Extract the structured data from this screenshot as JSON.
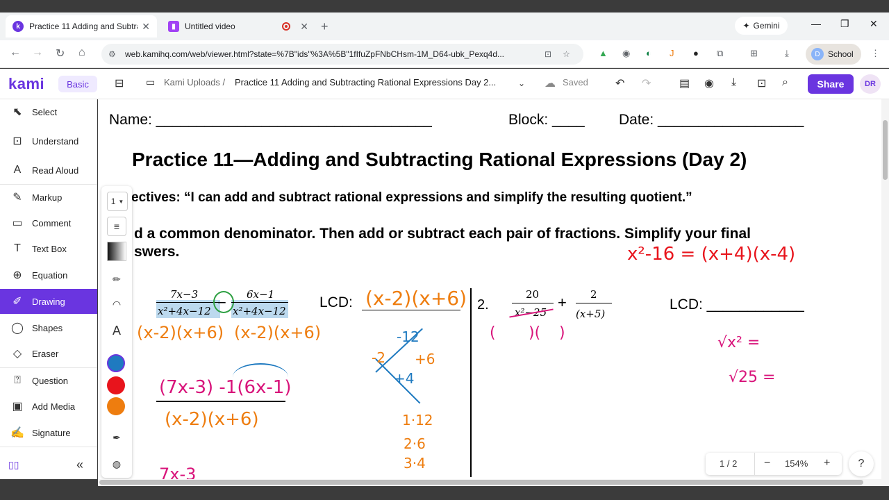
{
  "browser": {
    "tabs": [
      {
        "title": "Practice 11 Adding and Subtrac",
        "active": true,
        "favicon": "kami-icon"
      },
      {
        "title": "Untitled video",
        "active": false,
        "favicon": "video-icon"
      }
    ],
    "gemini_label": "Gemini",
    "url": "web.kamihq.com/web/viewer.html?state=%7B\"ids\"%3A%5B\"1fIfuZpFNbCHsm-1M_D64-ubk_Pexq4d...",
    "profile_initial": "D",
    "profile_label": "School"
  },
  "kami": {
    "logo": "kami",
    "plan": "Basic",
    "breadcrumb_root": "Kami Uploads /",
    "doc_title": "Practice 11 Adding and Subtracting Rational Expressions Day 2...",
    "saved": "Saved",
    "share": "Share",
    "user_initials": "DR"
  },
  "sidebar": {
    "tools": [
      {
        "label": "Select",
        "icon": "cursor-icon"
      },
      {
        "label": "Understand",
        "icon": "understand-icon"
      },
      {
        "label": "Read Aloud",
        "icon": "read-aloud-icon"
      },
      {
        "label": "Markup",
        "icon": "markup-icon"
      },
      {
        "label": "Comment",
        "icon": "comment-icon"
      },
      {
        "label": "Text Box",
        "icon": "text-box-icon"
      },
      {
        "label": "Equation",
        "icon": "equation-icon"
      },
      {
        "label": "Drawing",
        "icon": "pen-icon",
        "active": true
      },
      {
        "label": "Shapes",
        "icon": "shapes-icon"
      },
      {
        "label": "Eraser",
        "icon": "eraser-icon"
      },
      {
        "label": "Question",
        "icon": "question-icon"
      },
      {
        "label": "Add Media",
        "icon": "media-icon"
      },
      {
        "label": "Signature",
        "icon": "signature-icon"
      }
    ],
    "collapse": "«"
  },
  "palette": {
    "stroke_size": "1",
    "colors": [
      "#1f7ac0",
      "#e8141c",
      "#ee7d0f"
    ]
  },
  "document": {
    "name_label": "Name: __________________________________",
    "block_label": "Block: ____",
    "date_label": "Date: __________________",
    "title": "Practice 11—Adding and Subtracting Rational Expressions (Day 2)",
    "objectives": "ectives:  “I can add and subtract rational expressions and simplify the resulting quotient.”",
    "instructions_1": "d a common denominator. Then add or subtract each pair of fractions. Simplify your final",
    "instructions_2": "swers.",
    "p1_num1": "7x−3",
    "p1_den1": "x²+4x−12",
    "p1_op": "−",
    "p1_num2": "6x−1",
    "p1_den2": "x²+4x−12",
    "lcd_label": "LCD:",
    "p2_label": "2.",
    "p2_num1": "20",
    "p2_den1": "x²−25",
    "p2_op": "+",
    "p2_num2": "2",
    "p2_den2": "(x+5)",
    "lcd_label2": "LCD: ____________"
  },
  "handwriting": {
    "hw_factor1": "(x-2)(x+6)",
    "hw_factor2": "(x-2)(x+6)",
    "hw_lcd": "(x-2)(x+6)",
    "hw_expr": "(7x-3) -1(6x-1)",
    "hw_den": "(x-2)(x+6)",
    "hw_next": "7x-3",
    "hw_x_top": "-12",
    "hw_x_left": "-2",
    "hw_x_right": "+6",
    "hw_x_bottom": "+4",
    "hw_f1": "1·12",
    "hw_f2": "2·6",
    "hw_f3": "3·4",
    "hw_diff_squares": "x²-16 = (x+4)(x-4)",
    "hw_sqrt1": "√x² =",
    "hw_sqrt2": "√25 =",
    "hw_p2_paren1": "(",
    "hw_p2_paren2": ")(",
    "hw_p2_paren3": ")"
  },
  "pager": {
    "page": "1 / 2",
    "minus": "−",
    "zoom": "154%",
    "plus": "+",
    "help": "?"
  }
}
